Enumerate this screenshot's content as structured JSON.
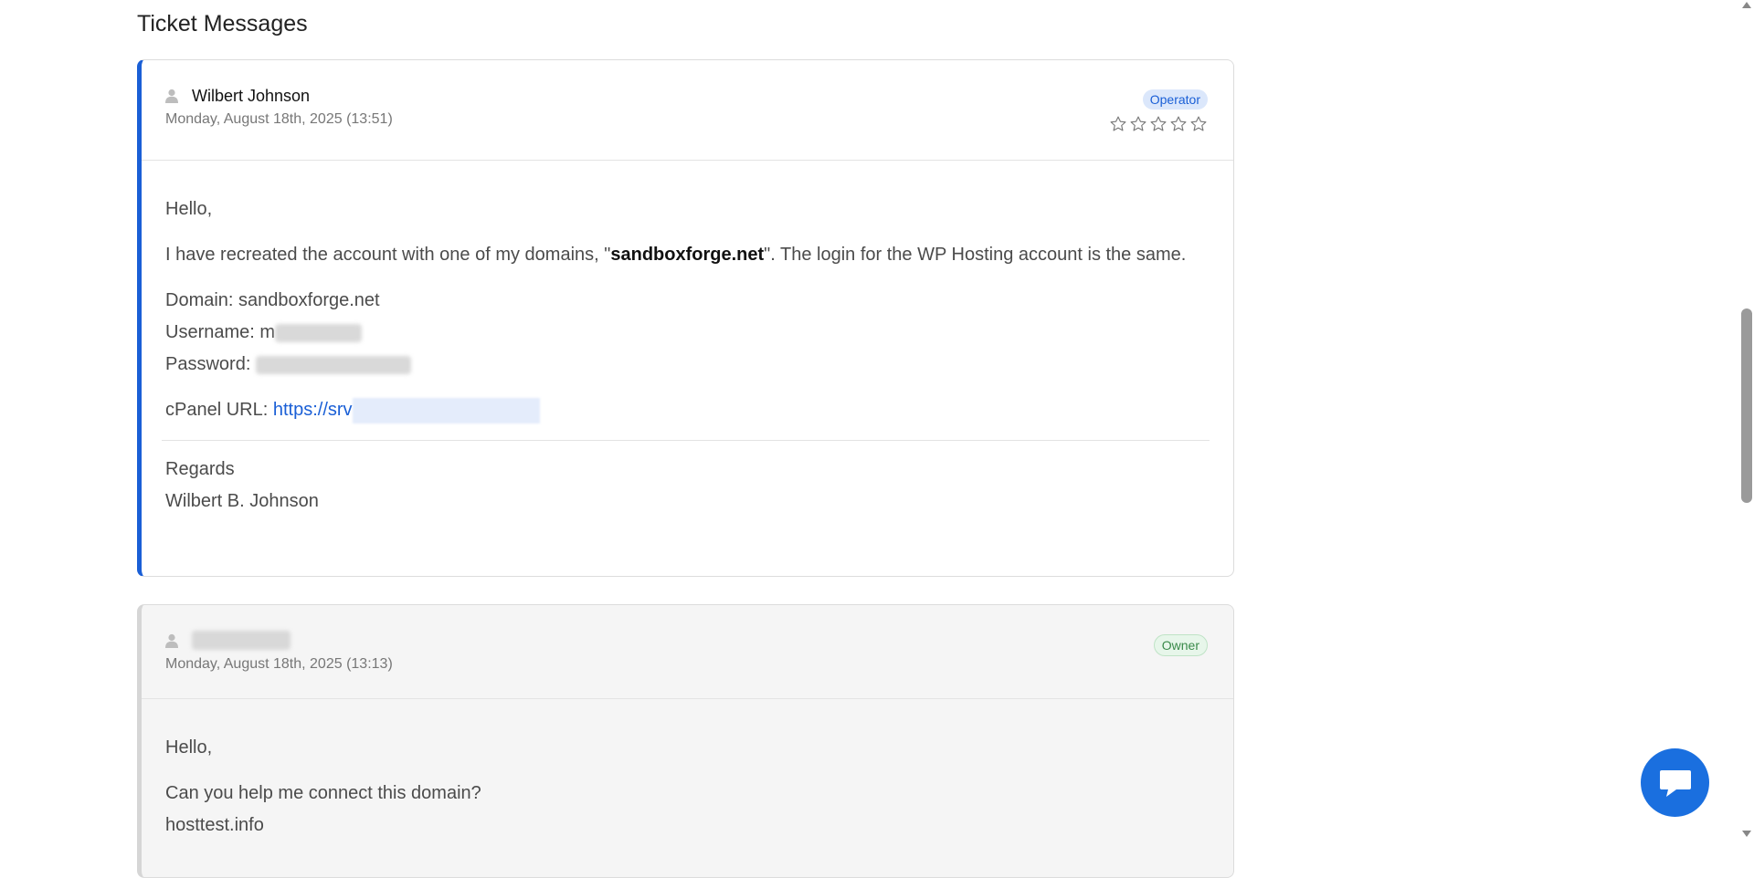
{
  "page": {
    "title": "Ticket Messages"
  },
  "messages": [
    {
      "author": "Wilbert Johnson",
      "date": "Monday, August 18th, 2025 (13:51)",
      "role": "Operator",
      "rating_stars": 5,
      "greeting": "Hello,",
      "intro_before": "I have recreated the account with one of my domains, \"",
      "intro_bold": "sandboxforge.net",
      "intro_after": "\". The login for the WP Hosting account is the same.",
      "domain_line": "Domain: sandboxforge.net",
      "username_label": "Username: m",
      "password_label": "Password:",
      "cpanel_label": "cPanel URL: ",
      "cpanel_url_visible": "https://srv",
      "regards": "Regards",
      "signature": "Wilbert B. Johnson"
    },
    {
      "author": "",
      "date": "Monday, August 18th, 2025 (13:13)",
      "role": "Owner",
      "greeting": "Hello,",
      "question": "Can you help me connect this domain?",
      "domain": "hosttest.info"
    }
  ],
  "colors": {
    "accent": "#1a5fd6",
    "operator_badge_bg": "#dbe7fb",
    "owner_badge_bg": "#e7f6ea",
    "owner_badge_text": "#3a8a4a",
    "chat_button": "#1a6fdf"
  },
  "icons": {
    "author": "user-icon",
    "rating": "star-outline-icon",
    "chat": "chat-bubble-icon"
  }
}
